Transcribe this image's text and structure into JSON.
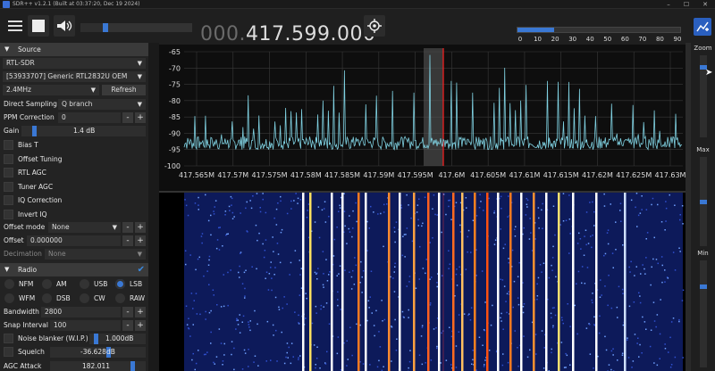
{
  "window": {
    "title": "SDR++ v1.2.1 (Built at 03:37:20, Dec 19 2024)",
    "minimize": "–",
    "maximize": "☐",
    "close": "✕"
  },
  "toolbar": {
    "menu_icon": "hamburger-icon",
    "stop_icon": "stop-icon",
    "volume_icon": "speaker-icon",
    "volume_level": 0.2,
    "frequency_dim": "000.",
    "frequency_main": "417.599.000",
    "tune_icon": "crosshair-icon",
    "snr_scale": [
      "0",
      "10",
      "20",
      "30",
      "40",
      "50",
      "60",
      "70",
      "80",
      "90"
    ],
    "snr_level": 20,
    "logo_icon": "sdrpp-logo-icon"
  },
  "sidebar": {
    "source": {
      "header": "Source",
      "device_type": "RTL-SDR",
      "device": "[53933707] Generic RTL2832U OEM",
      "samplerate": "2.4MHz",
      "refresh": "Refresh",
      "direct_sampling_label": "Direct Sampling",
      "direct_sampling_value": "Q branch",
      "ppm_label": "PPM Correction",
      "ppm_value": "0",
      "gain_label": "Gain",
      "gain_value": "1.4 dB",
      "checks": [
        "Bias T",
        "Offset Tuning",
        "RTL AGC",
        "Tuner AGC",
        "IQ Correction",
        "Invert IQ"
      ],
      "offset_mode_label": "Offset mode",
      "offset_mode_value": "None",
      "offset_label": "Offset",
      "offset_value": "0.000000",
      "decimation_label": "Decimation",
      "decimation_value": "None"
    },
    "radio": {
      "header": "Radio",
      "modes": [
        "NFM",
        "AM",
        "USB",
        "LSB",
        "WFM",
        "DSB",
        "CW",
        "RAW"
      ],
      "selected_mode": "LSB",
      "bandwidth_label": "Bandwidth",
      "bandwidth_value": "2800",
      "snap_label": "Snap Interval",
      "snap_value": "100",
      "noise_blanker_label": "Noise blanker (W.I.P.)",
      "noise_blanker_value": "1.000dB",
      "squelch_label": "Squelch",
      "squelch_value": "-36.628dB",
      "agc_label": "AGC Attack",
      "agc_value": "182.011"
    },
    "plus": "+",
    "minus": "-"
  },
  "spectrum": {
    "y_labels": [
      "-65",
      "-70",
      "-75",
      "-80",
      "-85",
      "-90",
      "-95",
      "-100"
    ],
    "x_labels": [
      "417.565M",
      "417.57M",
      "417.575M",
      "417.58M",
      "417.585M",
      "417.59M",
      "417.595M",
      "417.6M",
      "417.605M",
      "417.61M",
      "417.615M",
      "417.62M",
      "417.625M",
      "417.63M"
    ],
    "trace_color": "#7fd0e0",
    "marker_color": "#ff2020"
  },
  "right_panel": {
    "zoom": "Zoom",
    "max": "Max",
    "min": "Min"
  }
}
